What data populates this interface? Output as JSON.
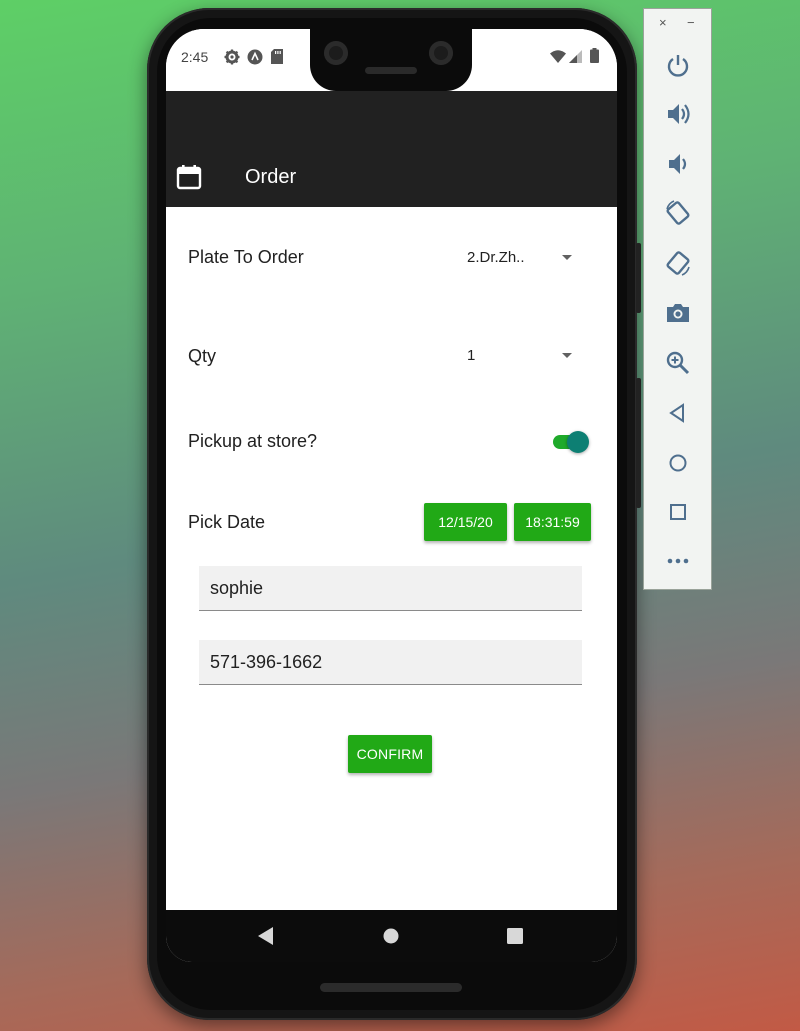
{
  "status_bar": {
    "time": "2:45"
  },
  "app_bar": {
    "title": "Order",
    "icon": "calendar-icon"
  },
  "form": {
    "plate_label": "Plate To Order",
    "plate_value": "2.Dr.Zh..",
    "qty_label": "Qty",
    "qty_value": "1",
    "pickup_label": "Pickup at store?",
    "pickup_checked": true,
    "date_label": "Pick Date",
    "date_value": "12/15/20",
    "time_value": "18:31:59",
    "name_value": "sophie",
    "phone_value": "571-396-1662",
    "confirm_label": "CONFIRM"
  },
  "colors": {
    "accent_green": "#21a916",
    "switch_thumb": "#0d7f73",
    "appbar": "#212121"
  },
  "nav_bar": {
    "items": [
      "back-icon",
      "home-icon",
      "recents-icon"
    ]
  },
  "emulator_panel": {
    "window_controls": [
      "×",
      "−"
    ],
    "tools": [
      "power-icon",
      "volume-up-icon",
      "volume-down-icon",
      "rotate-left-icon",
      "rotate-right-icon",
      "camera-icon",
      "zoom-icon",
      "back-icon",
      "home-icon",
      "overview-icon",
      "more-icon"
    ]
  }
}
